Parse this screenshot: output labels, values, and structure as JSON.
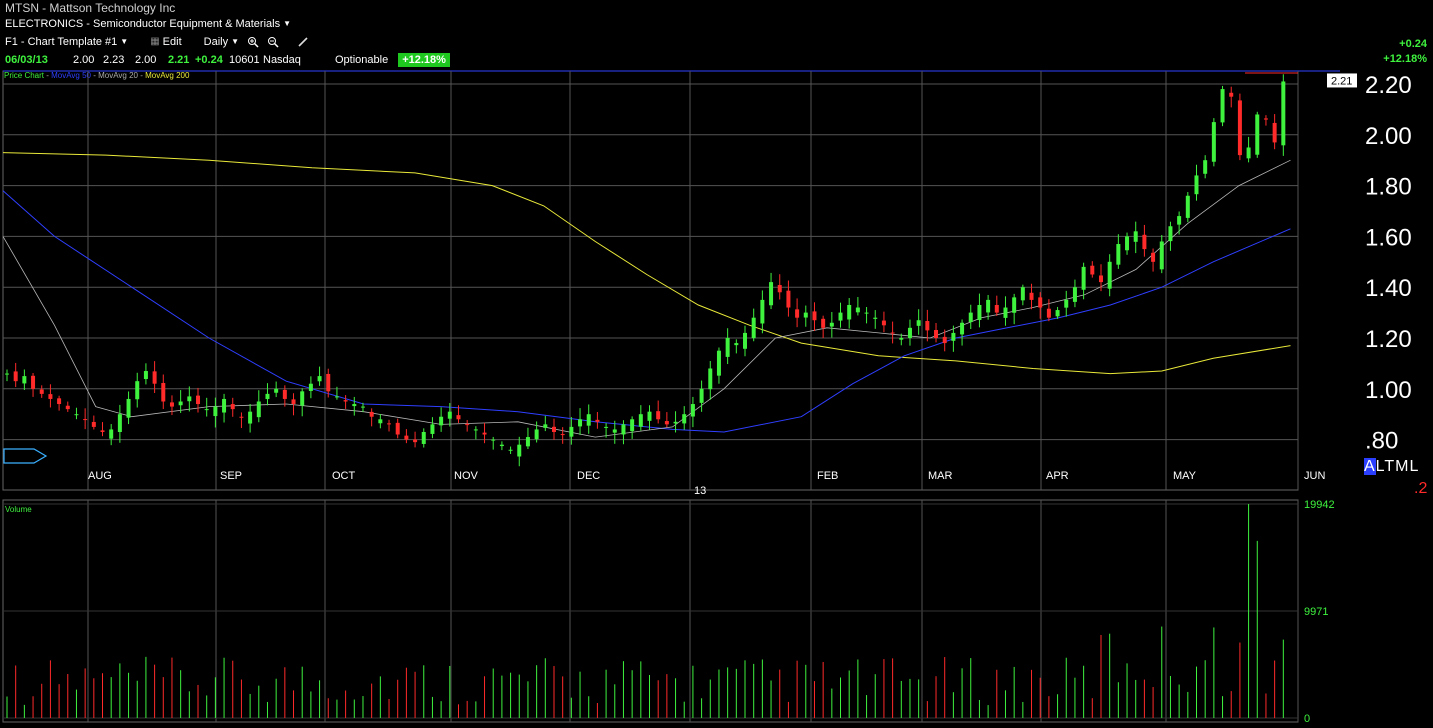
{
  "header": {
    "symbol": "MTSN",
    "company": "Mattson Technology Inc",
    "sector": "ELECTRONICS - Semiconductor Equipment & Materials",
    "template": "F1 - Chart Template #1",
    "edit_label": "Edit",
    "period": "Daily"
  },
  "quote": {
    "date": "06/03/13",
    "open": "2.00",
    "high": "2.23",
    "low": "2.00",
    "close": "2.21",
    "change": "+0.24",
    "volume": "10601",
    "exchange": "Nasdaq",
    "optionable": "Optionable",
    "pct": "+12.18%"
  },
  "right_change": {
    "abs": "+0.24",
    "pct": "+12.18%"
  },
  "legend": {
    "price_chart": "Price Chart",
    "ma50": "MovAvg 50",
    "ma20": "MovAvg 20",
    "ma200": "MovAvg 200"
  },
  "volume_label": "Volume",
  "bottom_right": {
    "modes": [
      "A",
      "L",
      "T",
      "M",
      "L"
    ],
    "selected": "A",
    "value": ".2"
  },
  "colors": {
    "up": "#3ef23e",
    "down": "#ff2a2a",
    "ma50": "#2f3fff",
    "ma20": "#b8b8b8",
    "ma200": "#e9e93a",
    "grid": "#555555"
  },
  "chart_data": [
    {
      "type": "candlestick",
      "title": "MTSN - Mattson Technology Inc",
      "y_ticks": [
        "2.20",
        "2.00",
        "1.80",
        "1.60",
        "1.40",
        "1.20",
        "1.00",
        ".80"
      ],
      "y_values": [
        2.2,
        2.0,
        1.8,
        1.6,
        1.4,
        1.2,
        1.0,
        0.8
      ],
      "ylim": [
        0.73,
        2.24
      ],
      "x_ticks": [
        "AUG",
        "SEP",
        "OCT",
        "NOV",
        "DEC",
        "13",
        "FEB",
        "MAR",
        "APR",
        "MAY",
        "JUN"
      ],
      "last_price_tag": "2.21",
      "series": [
        {
          "name": "MovAvg 200",
          "points": [
            [
              0,
              1.93
            ],
            [
              20,
              1.92
            ],
            [
              40,
              1.9
            ],
            [
              60,
              1.87
            ],
            [
              80,
              1.85
            ],
            [
              95,
              1.8
            ],
            [
              105,
              1.72
            ],
            [
              115,
              1.58
            ],
            [
              125,
              1.45
            ],
            [
              135,
              1.33
            ],
            [
              145,
              1.25
            ],
            [
              155,
              1.18
            ],
            [
              170,
              1.13
            ],
            [
              185,
              1.11
            ],
            [
              200,
              1.08
            ],
            [
              215,
              1.06
            ],
            [
              225,
              1.07
            ],
            [
              235,
              1.12
            ],
            [
              250,
              1.17
            ]
          ]
        },
        {
          "name": "MovAvg 50",
          "points": [
            [
              0,
              1.78
            ],
            [
              10,
              1.6
            ],
            [
              25,
              1.4
            ],
            [
              40,
              1.2
            ],
            [
              55,
              1.03
            ],
            [
              70,
              0.94
            ],
            [
              85,
              0.93
            ],
            [
              100,
              0.91
            ],
            [
              115,
              0.87
            ],
            [
              130,
              0.84
            ],
            [
              140,
              0.83
            ],
            [
              155,
              0.89
            ],
            [
              165,
              1.02
            ],
            [
              175,
              1.13
            ],
            [
              185,
              1.2
            ],
            [
              195,
              1.24
            ],
            [
              205,
              1.28
            ],
            [
              215,
              1.33
            ],
            [
              225,
              1.4
            ],
            [
              235,
              1.5
            ],
            [
              250,
              1.63
            ]
          ]
        },
        {
          "name": "MovAvg 20",
          "points": [
            [
              0,
              1.6
            ],
            [
              10,
              1.25
            ],
            [
              18,
              0.93
            ],
            [
              25,
              0.89
            ],
            [
              40,
              0.93
            ],
            [
              55,
              0.94
            ],
            [
              70,
              0.91
            ],
            [
              85,
              0.86
            ],
            [
              100,
              0.87
            ],
            [
              115,
              0.81
            ],
            [
              130,
              0.85
            ],
            [
              140,
              1.0
            ],
            [
              150,
              1.2
            ],
            [
              160,
              1.24
            ],
            [
              170,
              1.22
            ],
            [
              180,
              1.2
            ],
            [
              190,
              1.28
            ],
            [
              200,
              1.32
            ],
            [
              210,
              1.37
            ],
            [
              220,
              1.47
            ],
            [
              230,
              1.65
            ],
            [
              240,
              1.8
            ],
            [
              250,
              1.9
            ]
          ]
        }
      ]
    },
    {
      "type": "bar",
      "title": "Volume",
      "y_ticks": [
        "19942",
        "9971",
        "0"
      ],
      "y_values": [
        19942,
        9971,
        0
      ]
    }
  ]
}
